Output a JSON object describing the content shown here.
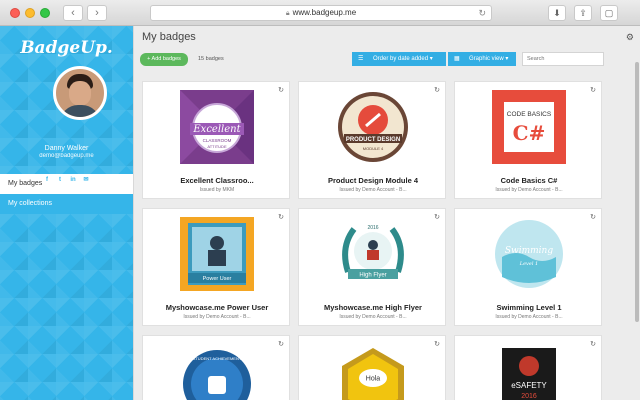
{
  "browser": {
    "url": "www.badgeup.me"
  },
  "sidebar": {
    "logo": "BadgeUp.",
    "user": {
      "name": "Danny Walker",
      "email": "demo@badgeup.me"
    },
    "social_icons": [
      "facebook-icon",
      "twitter-icon",
      "linkedin-icon",
      "email-icon"
    ],
    "nav": [
      {
        "label": "My badges",
        "active": true
      },
      {
        "label": "My collections",
        "active": false
      }
    ]
  },
  "main": {
    "title": "My badges",
    "toolbar": {
      "add_label": "+ Add badges",
      "count": "15 badges",
      "order_label": "Order by date added",
      "view_label": "Graphic view",
      "search_placeholder": "Search"
    },
    "badges": [
      {
        "title": "Excellent Classroo...",
        "issuer": "Issued by MKM",
        "art_text": [
          "Excellent",
          "CLASSROOM",
          "ATTITUDE"
        ]
      },
      {
        "title": "Product Design Module 4",
        "issuer": "Issued by Demo Account - B...",
        "art_text": [
          "PRODUCT DESIGN",
          "MODULE 4"
        ]
      },
      {
        "title": "Code Basics C#",
        "issuer": "Issued by Demo Account - B...",
        "art_text": [
          "CODE BASICS",
          "C#"
        ]
      },
      {
        "title": "Myshowcase.me Power User",
        "issuer": "Issued by Demo Account - B...",
        "art_text": [
          "Power User"
        ]
      },
      {
        "title": "Myshowcase.me High Flyer",
        "issuer": "Issued by Demo Account - B...",
        "art_text": [
          "2016",
          "High Flyer"
        ]
      },
      {
        "title": "Swimming Level 1",
        "issuer": "Issued by Demo Account - B...",
        "art_text": [
          "Swimming",
          "Level 1"
        ]
      },
      {
        "title": "",
        "issuer": "",
        "art_text": [
          "STUDENT ACHIEVEMENT"
        ]
      },
      {
        "title": "",
        "issuer": "",
        "art_text": [
          "Hola"
        ]
      },
      {
        "title": "",
        "issuer": "",
        "art_text": [
          "eSAFETY",
          "2016"
        ]
      }
    ]
  },
  "colors": {
    "accent": "#33aee4",
    "sidebar": "#35b5e9",
    "add_button": "#5cb85c"
  }
}
